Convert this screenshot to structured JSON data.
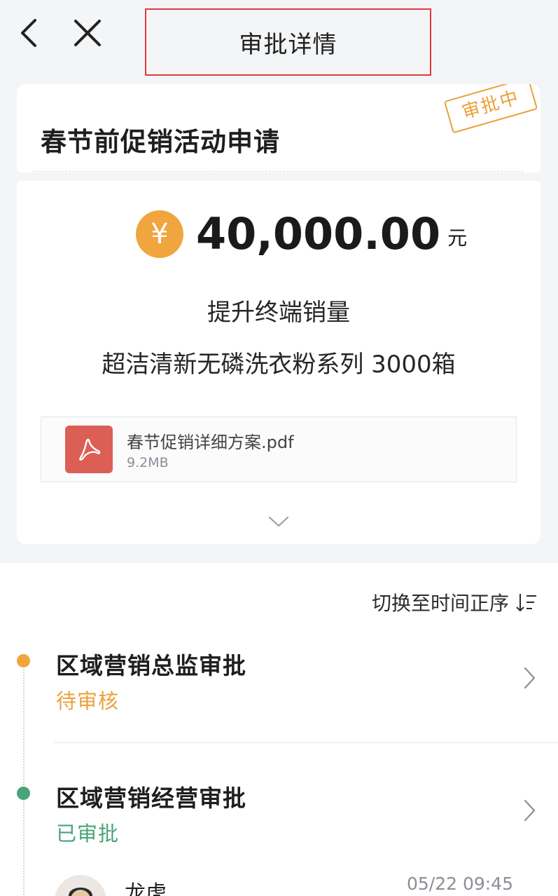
{
  "header": {
    "title": "审批详情",
    "back_icon": "chevron-left-icon",
    "close_icon": "close-icon"
  },
  "request": {
    "title": "春节前促销活动申请",
    "stamp": "审批中"
  },
  "details": {
    "currency_symbol": "¥",
    "amount": "40,000.00",
    "unit": "元",
    "purpose": "提升终端销量",
    "product": "超洁清新无磷洗衣粉系列 3000箱"
  },
  "attachment": {
    "file_name": "春节促销详细方案.pdf",
    "file_size": "9.2MB",
    "icon": "pdf-icon"
  },
  "timeline": {
    "sort_label": "切换至时间正序",
    "steps": [
      {
        "title": "区域营销总监审批",
        "status": "待审核"
      },
      {
        "title": "区域营销经营审批",
        "status": "已审批"
      }
    ],
    "approver": {
      "name": "龙虎",
      "time": "05/22 09:45"
    }
  },
  "colors": {
    "accent_orange": "#F0A53E",
    "status_green": "#4AA37A",
    "pdf_red": "#DC5F56",
    "highlight_red": "#E0393E"
  }
}
